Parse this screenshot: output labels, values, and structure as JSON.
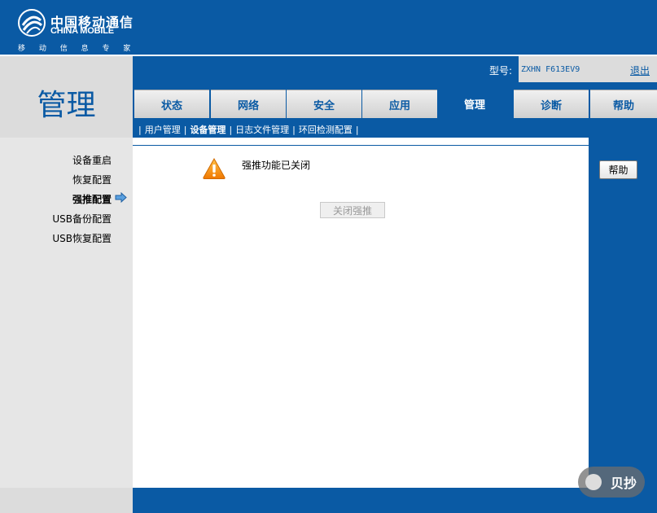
{
  "brand": {
    "name_cn": "中国移动通信",
    "name_en": "CHINA MOBILE",
    "slogan": "移 动 信 息 专 家"
  },
  "page_title": "管理",
  "device": {
    "model_label": "型号:",
    "model_value": "ZXHN F613EV9",
    "logout": "退出"
  },
  "tabs": [
    {
      "label": "状态",
      "active": false
    },
    {
      "label": "网络",
      "active": false
    },
    {
      "label": "安全",
      "active": false
    },
    {
      "label": "应用",
      "active": false
    },
    {
      "label": "管理",
      "active": true
    },
    {
      "label": "诊断",
      "active": false
    },
    {
      "label": "帮助",
      "active": false
    }
  ],
  "subnav": [
    {
      "label": "用户管理",
      "active": false
    },
    {
      "label": "设备管理",
      "active": true
    },
    {
      "label": "日志文件管理",
      "active": false
    },
    {
      "label": "环回检测配置",
      "active": false
    }
  ],
  "sidebar": [
    {
      "label": "设备重启",
      "active": false
    },
    {
      "label": "恢复配置",
      "active": false
    },
    {
      "label": "强推配置",
      "active": true
    },
    {
      "label": "USB备份配置",
      "active": false
    },
    {
      "label": "USB恢复配置",
      "active": false
    }
  ],
  "main": {
    "status_text": "强推功能已关闭",
    "close_button": "关闭强推"
  },
  "help_button": "帮助",
  "watermark": "贝抄",
  "colors": {
    "primary": "#0a5aa4",
    "panel_gray": "#dcdcdc",
    "warning": "#f08c00"
  }
}
